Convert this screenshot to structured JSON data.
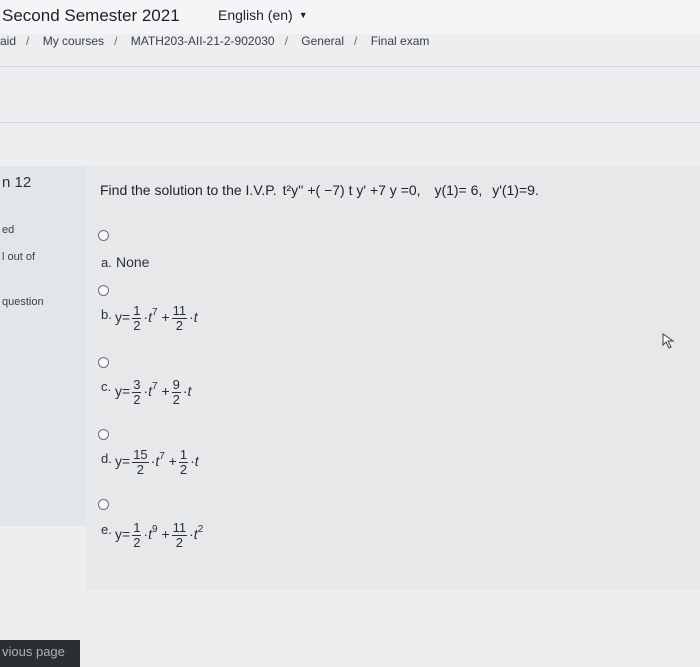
{
  "header": {
    "site_title": "Second Semester 2021",
    "language": "English (en)"
  },
  "breadcrumb": [
    "aid",
    "My courses",
    "MATH203-AII-21-2-902030",
    "General",
    "Final exam"
  ],
  "question_info": {
    "number_label": "n 12",
    "lines": [
      "ed",
      "l out of",
      "question"
    ]
  },
  "question": {
    "prompt": "Find the solution to the I.V.P.",
    "equation": "t²y'' +( −7) t y' +7 y =0,",
    "ic1": "y(1)= 6,",
    "ic2": "y'(1)=9."
  },
  "options": [
    {
      "letter": "a.",
      "text": "None"
    },
    {
      "letter": "b.",
      "lead": "y=",
      "c1_num": "1",
      "c1_den": "2",
      "t1": "t",
      "p1": "7",
      "op": "+",
      "c2_num": "11",
      "c2_den": "2",
      "t2": "t",
      "p2": ""
    },
    {
      "letter": "c.",
      "lead": "y=",
      "c1_num": "3",
      "c1_den": "2",
      "t1": "t",
      "p1": "7",
      "op": "+",
      "c2_num": "9",
      "c2_den": "2",
      "t2": "t",
      "p2": ""
    },
    {
      "letter": "d.",
      "lead": "y=",
      "c1_num": "15",
      "c1_den": "2",
      "t1": "t",
      "p1": "7",
      "op": "+",
      "c2_num": "1",
      "c2_den": "2",
      "t2": "t",
      "p2": ""
    },
    {
      "letter": "e.",
      "lead": "y=",
      "c1_num": "1",
      "c1_den": "2",
      "t1": "t",
      "p1": "9",
      "op": "+",
      "c2_num": "11",
      "c2_den": "2",
      "t2": "t",
      "p2": "2"
    }
  ],
  "footer": {
    "previous_page": "vious page"
  }
}
